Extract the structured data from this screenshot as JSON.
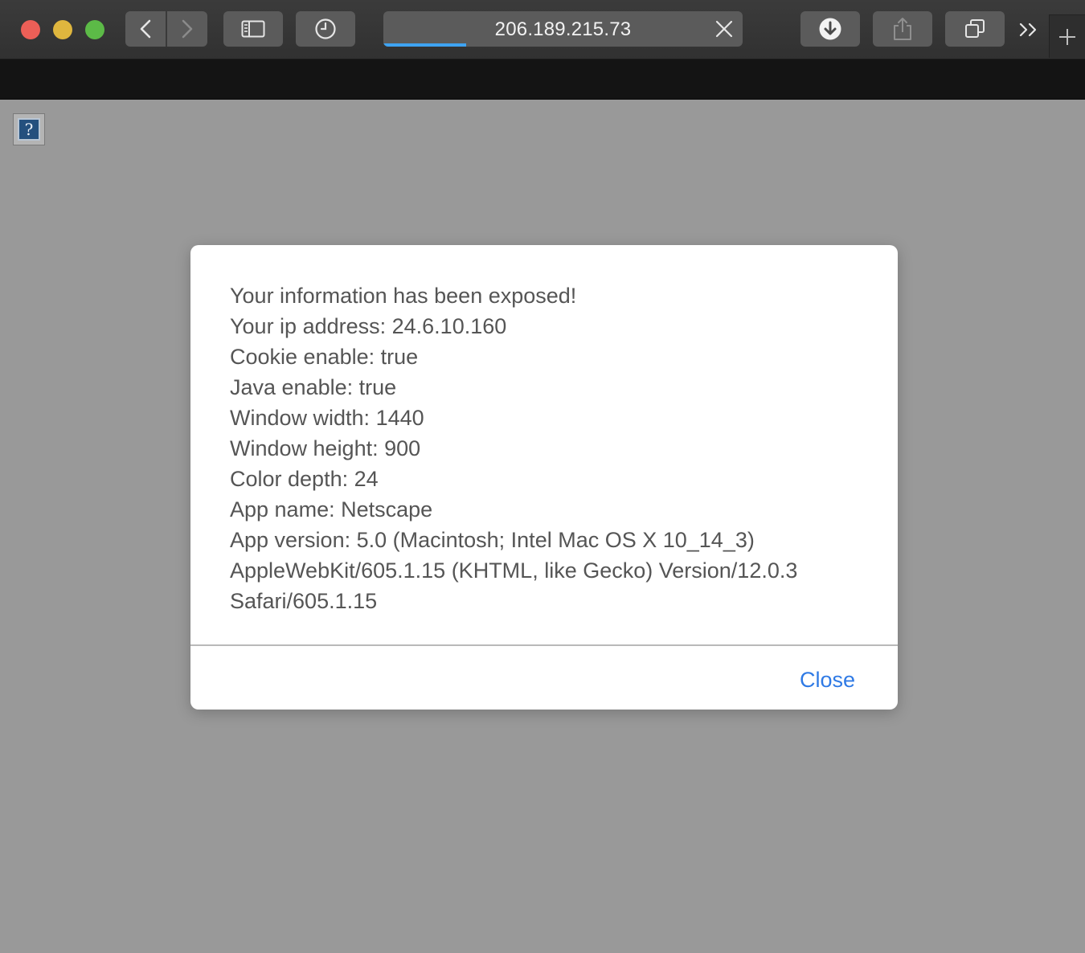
{
  "browser": {
    "address": "206.189.215.73",
    "load_progress": 0.23,
    "icons": {
      "back": "chevron-left-icon",
      "forward": "chevron-right-icon",
      "sidebar": "sidebar-icon",
      "history": "clock-icon",
      "stop": "close-icon",
      "downloads": "download-icon",
      "share": "share-icon",
      "tabs": "tab-overview-icon",
      "overflow": "double-chevron-icon",
      "new_tab": "plus-icon"
    },
    "colors": {
      "traffic_close": "#ec5f57",
      "traffic_min": "#dfb63e",
      "traffic_max": "#5cba47",
      "progress": "#3ea3f2"
    }
  },
  "page": {
    "broken_image_glyph": "?",
    "background": "#999999"
  },
  "dialog": {
    "lines": [
      "Your information has been exposed!",
      "Your ip address: 24.6.10.160",
      "Cookie enable: true",
      "Java enable: true",
      "Window width: 1440",
      "Window height: 900",
      "Color depth: 24",
      "App name: Netscape",
      "App version: 5.0 (Macintosh; Intel Mac OS X 10_14_3)",
      "AppleWebKit/605.1.15 (KHTML, like Gecko) Version/12.0.3",
      "Safari/605.1.15"
    ],
    "close_label": "Close",
    "link_color": "#2f7ae5"
  }
}
